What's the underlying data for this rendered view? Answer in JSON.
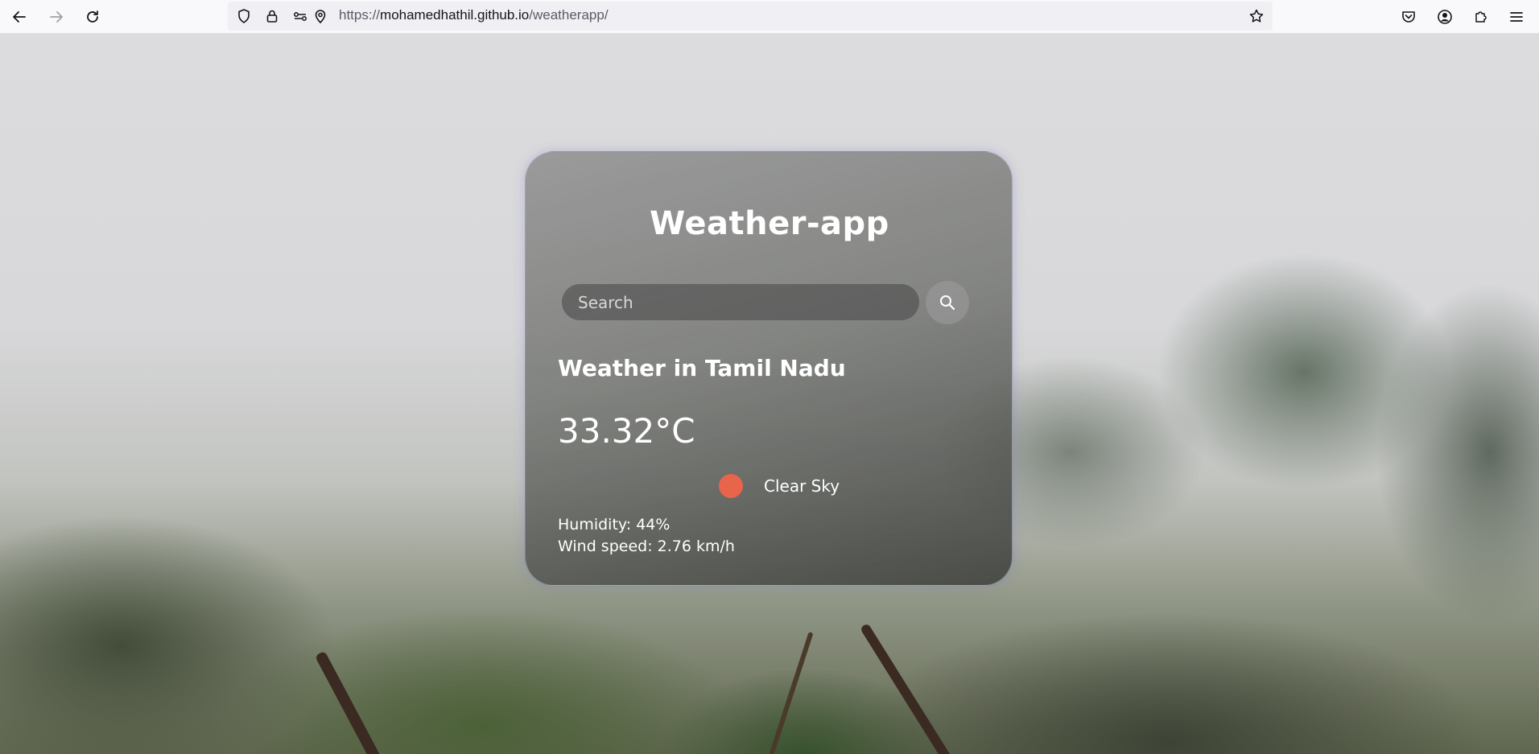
{
  "browser": {
    "url_scheme": "https://",
    "url_host": "mohamedhathil.github.io",
    "url_path": "/weatherapp/"
  },
  "icons": {
    "back": "back-arrow-icon",
    "forward": "forward-arrow-icon",
    "reload": "reload-icon",
    "shield": "shield-icon",
    "lock": "lock-icon",
    "permissions": "permissions-icon",
    "location": "location-pin-icon",
    "bookmark": "star-icon",
    "pocket": "pocket-icon",
    "account": "account-icon",
    "extensions": "puzzle-icon",
    "menu": "hamburger-menu-icon",
    "search": "search-icon",
    "weather": "weather-condition-icon"
  },
  "colors": {
    "weather_icon": "#e8644a"
  },
  "app": {
    "title": "Weather-app",
    "search_placeholder": "Search",
    "city_heading": "Weather in Tamil Nadu",
    "temperature": "33.32°C",
    "description": "Clear Sky",
    "humidity": "Humidity: 44%",
    "wind": "Wind speed: 2.76 km/h"
  }
}
